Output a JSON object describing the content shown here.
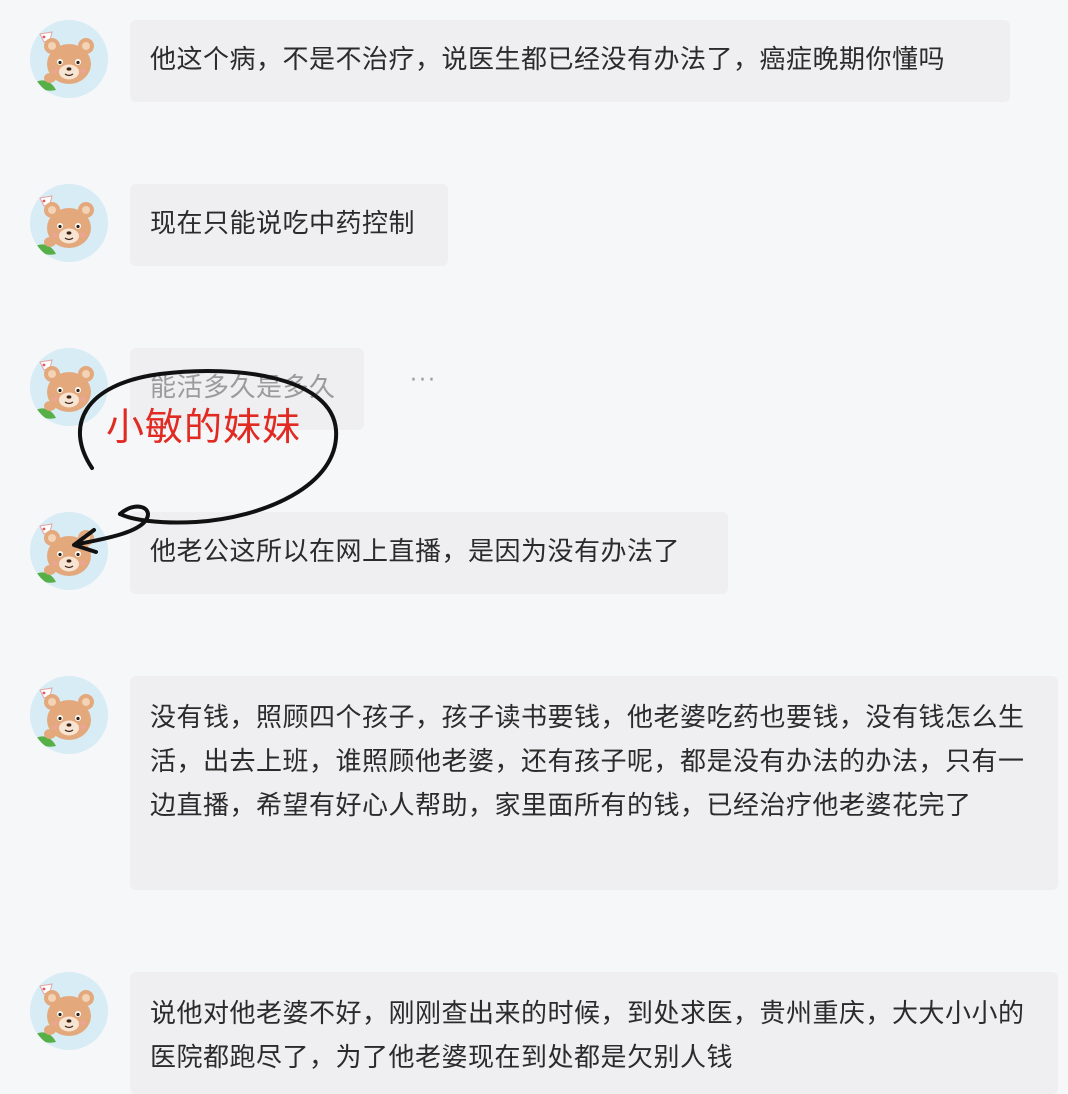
{
  "colors": {
    "background": "#f6f7f9",
    "bubble": "#efeff2",
    "text": "#2b2b2b",
    "annotation_red": "#e02a22",
    "avatar_bg": "#d8ecf6"
  },
  "avatar_icon": "bear-avatar-icon",
  "messages": [
    {
      "text": "他这个病，不是不治疗，说医生都已经没有办法了，癌症晚期你懂吗"
    },
    {
      "text": "现在只能说吃中药控制"
    },
    {
      "text": "能活多久是多久",
      "more": "···"
    },
    {
      "text": "他老公这所以在网上直播，是因为没有办法了"
    },
    {
      "text": "没有钱，照顾四个孩子，孩子读书要钱，他老婆吃药也要钱，没有钱怎么生活，出去上班，谁照顾他老婆，还有孩子呢，都是没有办法的办法，只有一边直播，希望有好心人帮助，家里面所有的钱，已经治疗他老婆花完了"
    },
    {
      "text": "说他对他老婆不好，刚刚查出来的时候，到处求医，贵州重庆，大大小小的医院都跑尽了，为了他老婆现在到处都是欠别人钱"
    }
  ],
  "annotation": {
    "label": "小敏的妹妹"
  }
}
